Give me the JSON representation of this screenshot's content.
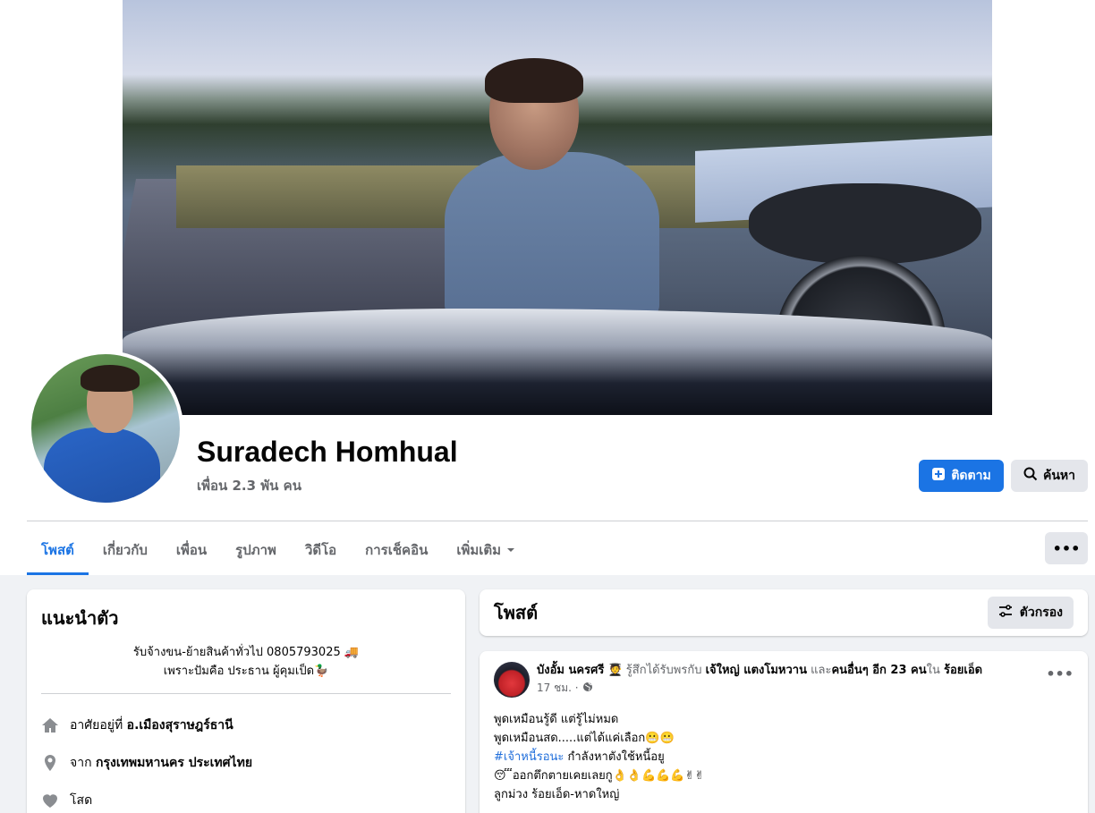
{
  "profile": {
    "name": "Suradech Homhual",
    "friends": "เพื่อน 2.3 พัน คน",
    "follow_label": "ติดตาม",
    "search_label": "ค้นหา"
  },
  "tabs": [
    {
      "label": "โพสต์"
    },
    {
      "label": "เกี่ยวกับ"
    },
    {
      "label": "เพื่อน"
    },
    {
      "label": "รูปภาพ"
    },
    {
      "label": "วิดีโอ"
    },
    {
      "label": "การเช็คอิน"
    },
    {
      "label": "เพิ่มเติม"
    }
  ],
  "more_button": "•••",
  "intro": {
    "title": "แนะนำตัว",
    "bio_line1": "รับจ้างขน-ย้ายสินค้าทั่วไป 0805793025 🚚",
    "bio_line2": "เพราะปัมคือ ประธาน ผู้คุมเป็ด🦆",
    "lives_prefix": "อาศัยอยู่ที่",
    "lives_value": "อ.เมืองสุราษฎร์ธานี",
    "from_prefix": "จาก",
    "from_value": "กรุงเทพมหานคร ประเทศไทย",
    "relationship": "โสด"
  },
  "posts": {
    "title": "โพสต์",
    "filter_label": "ตัวกรอง"
  },
  "post": {
    "author": "บังอั้ม นครศรี",
    "author_emoji": "🧑‍🎓",
    "feeling": "รู้สึกได้รับพรกับ",
    "tagged": "เจ้ใหญ่ แตงโมหวาน",
    "and_text": "และ",
    "others": "คนอื่นๆ อีก 23 คน",
    "in_text": "ใน",
    "location": "ร้อยเอ็ด",
    "time": "17 ชม. ·",
    "line1": "พูดเหมือนรู้ดี แต่รู้ไม่หมด",
    "line2": "พูดเหมือนสด.....แต่ได้แค่เลือก😬😬",
    "hashtag": "#เจ้าหนี้รอนะ",
    "line3_rest": " กำลังหาตังใช้หนี้อยู",
    "line4": "😴ออกตึกตายเคยเลยกู👌👌💪💪💪✌✌",
    "line5": "ลูกม่วง ร้อยเอ็ด-หาดใหญ่"
  }
}
